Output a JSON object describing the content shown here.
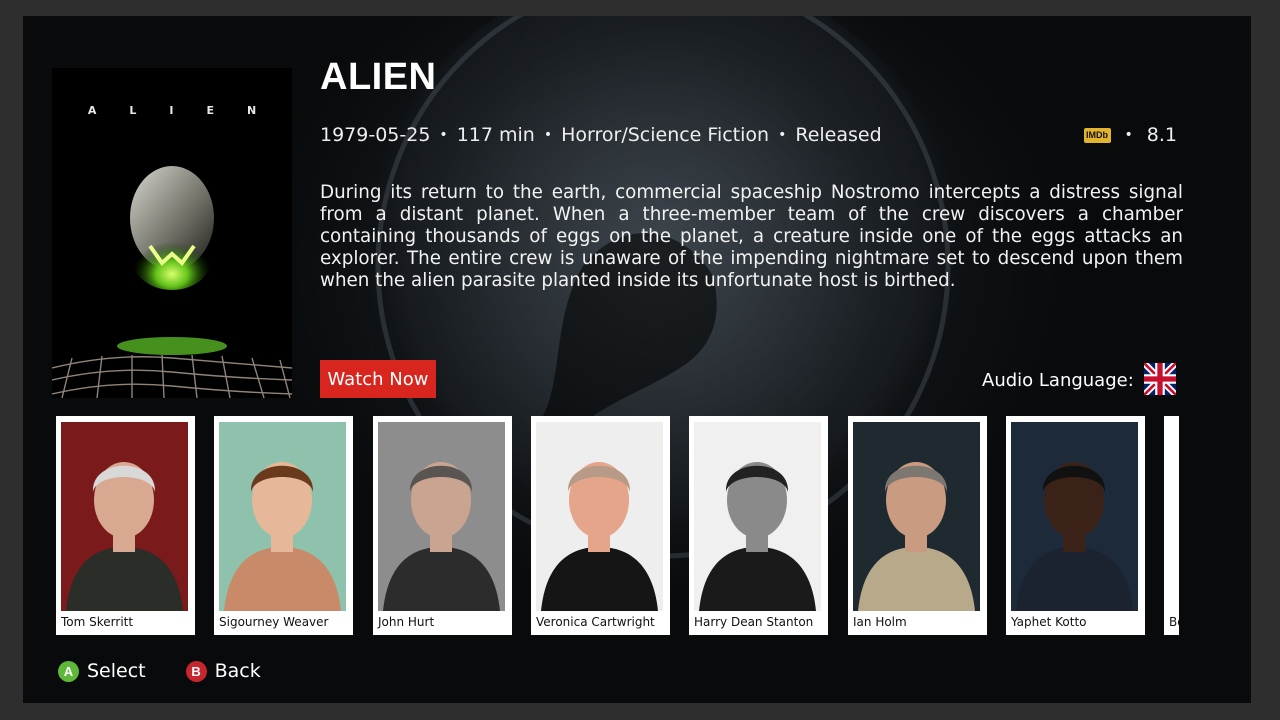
{
  "movie": {
    "title": "ALIEN",
    "poster_title": "ALIEN",
    "release_date": "1979-05-25",
    "runtime": "117 min",
    "genres": "Horror/Science Fiction",
    "status": "Released",
    "rating_source": "IMDb",
    "rating": "8.1",
    "description": "During its return to the earth, commercial spaceship Nostromo intercepts a distress signal from a distant planet. When a three-member team of the crew discovers a chamber containing thousands of eggs on the planet, a creature inside one of the eggs attacks an explorer. The entire crew is unaware of the impending nightmare set to descend upon them when the alien parasite planted inside its unfortunate host is birthed."
  },
  "actions": {
    "watch_now": "Watch Now",
    "audio_language_label": "Audio Language:",
    "audio_language_icon": "uk-flag-icon"
  },
  "cast": [
    {
      "name": "Tom Skerritt",
      "bg": "#7a1a1a",
      "skin": "#d9a890",
      "hair": "#d8d8d8",
      "clothes": "#2a2d28"
    },
    {
      "name": "Sigourney Weaver",
      "bg": "#8fc2ad",
      "skin": "#e7b79a",
      "hair": "#6b3a1c",
      "clothes": "#c98a6a"
    },
    {
      "name": "John Hurt",
      "bg": "#8d8d8d",
      "skin": "#c9a491",
      "hair": "#5a5550",
      "clothes": "#2c2c2c"
    },
    {
      "name": "Veronica Cartwright",
      "bg": "#eeeeee",
      "skin": "#e5a58a",
      "hair": "#b89b86",
      "clothes": "#151515"
    },
    {
      "name": "Harry Dean Stanton",
      "bg": "#f0f0f0",
      "skin": "#8a8a8a",
      "hair": "#222222",
      "clothes": "#1a1a1a"
    },
    {
      "name": "Ian Holm",
      "bg": "#1f2a30",
      "skin": "#c99b80",
      "hair": "#7d7772",
      "clothes": "#b8a98a"
    },
    {
      "name": "Yaphet Kotto",
      "bg": "#1d2a3a",
      "skin": "#3a2218",
      "hair": "#111111",
      "clothes": "#1b2230"
    },
    {
      "name": "Bo",
      "bg": "#ffffff",
      "skin": "#ffffff",
      "hair": "#ffffff",
      "clothes": "#ffffff"
    }
  ],
  "footer": {
    "select_button": "A",
    "select_label": "Select",
    "back_button": "B",
    "back_label": "Back"
  },
  "colors": {
    "accent_red": "#d8261e",
    "button_a": "#5fb83a",
    "button_b": "#c8262e",
    "imdb_yellow": "#e3b42d"
  }
}
